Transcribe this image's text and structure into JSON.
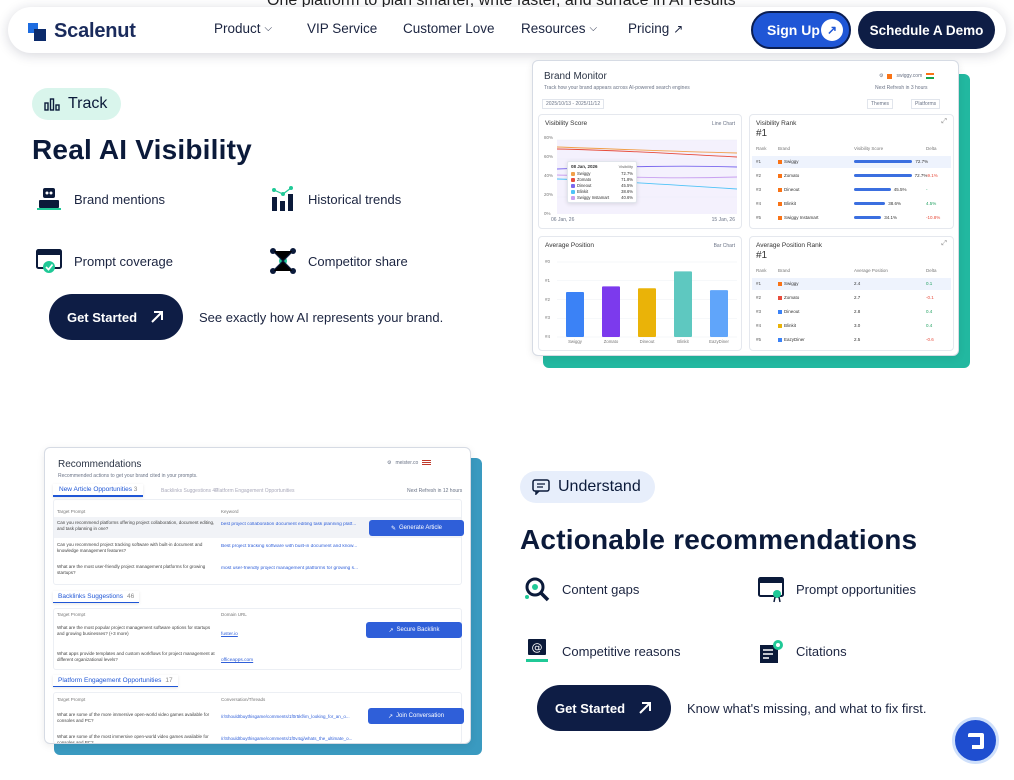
{
  "top_banner": "One platform to plan smarter, write faster, and surface in AI results",
  "nav": {
    "brand": "Scalenut",
    "items": [
      {
        "label": "Product",
        "has_dropdown": true
      },
      {
        "label": "VIP Service",
        "has_dropdown": false
      },
      {
        "label": "Customer Love",
        "has_dropdown": false
      },
      {
        "label": "Resources",
        "has_dropdown": true
      },
      {
        "label": "Pricing",
        "has_dropdown": false,
        "icon": "external-arrow-icon"
      }
    ],
    "signup": "Sign Up",
    "demo": "Schedule A Demo"
  },
  "track": {
    "pill": "Track",
    "title": "Real AI Visibility",
    "features": [
      "Brand mentions",
      "Historical trends",
      "Prompt coverage",
      "Competitor share"
    ],
    "cta": "Get Started",
    "note": "See exactly how AI represents your brand."
  },
  "brand_monitor": {
    "title": "Brand Monitor",
    "subtitle": "Track how your brand appears across AI-powered search engines",
    "domain": "swiggy.com",
    "date_range": "2025/10/13 - 2025/11/12",
    "filters": [
      "Themes",
      "Platforms"
    ],
    "last_refresh": "Next Refresh in 3 hours",
    "visibility_score": {
      "title": "Visibility Score",
      "chart_type_label": "Line Chart",
      "y_ticks": [
        "80%",
        "60%",
        "40%",
        "20%",
        "0%"
      ],
      "x_ticks": [
        "06 Jan, 26",
        "15 Jan, 26"
      ],
      "tooltip_date": "08 Jan, 2026",
      "tooltip_header": "Visibility",
      "tooltip_rows": [
        {
          "name": "Swiggy",
          "value": "72.7%",
          "color": "#f0a04b"
        },
        {
          "name": "Zomato",
          "value": "71.8%",
          "color": "#e74c3c"
        },
        {
          "name": "Dineout",
          "value": "45.5%",
          "color": "#7b68ee"
        },
        {
          "name": "Blinkit",
          "value": "38.6%",
          "color": "#4fc3f7"
        },
        {
          "name": "Swiggy Instamart",
          "value": "40.6%",
          "color": "#c9a0f0"
        }
      ]
    },
    "visibility_rank": {
      "title": "Visibility Rank",
      "rank": "#1",
      "headers": [
        "Rank",
        "Brand",
        "Visibility Score",
        "Delta"
      ],
      "rows": [
        {
          "rank": "#1",
          "brand": "Swiggy",
          "score": "72.7%",
          "delta": "",
          "fill": 0.73
        },
        {
          "rank": "#2",
          "brand": "Zomato",
          "score": "72.7%",
          "delta": "-9.1%",
          "fill": 0.72
        },
        {
          "rank": "#3",
          "brand": "Dineout",
          "score": "45.5%",
          "delta": "-",
          "fill": 0.46
        },
        {
          "rank": "#4",
          "brand": "Blinkit",
          "score": "38.6%",
          "delta": "4.5%",
          "fill": 0.39
        },
        {
          "rank": "#5",
          "brand": "Swiggy Instamart",
          "score": "34.1%",
          "delta": "-10.8%",
          "fill": 0.34
        }
      ]
    },
    "average_position": {
      "title": "Average Position",
      "chart_type_label": "Bar Chart",
      "y_ticks": [
        "#0",
        "#1",
        "#2",
        "#3",
        "#4"
      ]
    },
    "average_position_rank": {
      "title": "Average Position Rank",
      "rank": "#1",
      "headers": [
        "Rank",
        "Brand",
        "Average Position",
        "Delta"
      ],
      "rows": [
        {
          "rank": "#1",
          "brand": "Swiggy",
          "pos": "2.4",
          "delta": "0.1"
        },
        {
          "rank": "#2",
          "brand": "Zomato",
          "pos": "2.7",
          "delta": "-0.1"
        },
        {
          "rank": "#3",
          "brand": "Dineout",
          "pos": "2.8",
          "delta": "0.4"
        },
        {
          "rank": "#4",
          "brand": "Blinkit",
          "pos": "3.0",
          "delta": "0.4"
        },
        {
          "rank": "#5",
          "brand": "EazyDiner",
          "pos": "2.5",
          "delta": "-0.6"
        }
      ]
    }
  },
  "chart_data": {
    "type": "bar",
    "title": "Average Position",
    "categories": [
      "Swiggy",
      "Zomato",
      "Dineout",
      "Blinkit",
      "EazyDiner"
    ],
    "values": [
      2.4,
      2.7,
      2.6,
      3.5,
      2.5
    ],
    "colors": [
      "#3b82f6",
      "#7c3aed",
      "#eab308",
      "#5ec8c0",
      "#60a5fa"
    ],
    "ylim": [
      0,
      4
    ]
  },
  "recommendations": {
    "title": "Recommendations",
    "subtitle": "Recommended actions to get your brand cited in your prompts.",
    "domain": "meister.co",
    "tabs": [
      {
        "label": "New Article Opportunities",
        "count": "3"
      },
      {
        "label": "Backlinks Suggestions",
        "count": "46"
      },
      {
        "label": "Platform Engagement Opportunities",
        "count": ""
      }
    ],
    "last_refresh": "Next Refresh in 12 hours",
    "article_headers": [
      "Target Prompt",
      "Keyword"
    ],
    "articles": [
      {
        "prompt": "Can you recommend platforms offering project collaboration, document editing, and task planning in one?",
        "keyword": "best project collaboration document editing task planning platf..."
      },
      {
        "prompt": "Can you recommend project tracking software with built-in document and knowledge management features?",
        "keyword": "Best project tracking software with built-in document and know..."
      },
      {
        "prompt": "What are the most user-friendly project management platforms for growing startups?",
        "keyword": "most user-friendly project management platforms for growing s..."
      }
    ],
    "article_button": "Generate Article",
    "backlinks_title": "Backlinks Suggestions",
    "backlinks_count": "46",
    "backlink_headers": [
      "Target Prompt",
      "Domain URL"
    ],
    "backlinks": [
      {
        "prompt": "What are the most popular project management software options for startups and growing businesses? (+3 more)",
        "url": "fuster.io"
      },
      {
        "prompt": "What apps provide templates and custom workflows for project management at different organizational levels?",
        "url": "officeapps.com"
      }
    ],
    "backlink_button": "Secure Backlink",
    "platform_title": "Platform Engagement Opportunities",
    "platform_count": "17",
    "platform_headers": [
      "Target Prompt",
      "Conversation/Threads"
    ],
    "platform_rows": [
      {
        "prompt": "What are some of the more immersive open-world video games available for consoles and PC?",
        "url": "/r/ShouldIbuythisgame/comments/1f0r5kf/im_looking_for_an_o..."
      },
      {
        "prompt": "What are some of the most immersive open-world video games available for consoles and PC?",
        "url": "/r/ShouldIbuythisgame/comments/1f0v4qj/whats_the_ultimate_o..."
      }
    ],
    "platform_button": "Join Conversation"
  },
  "understand": {
    "pill": "Understand",
    "title": "Actionable recommendations",
    "features": [
      "Content gaps",
      "Prompt opportunities",
      "Competitive reasons",
      "Citations"
    ],
    "cta": "Get Started",
    "note": "Know what's missing, and what to fix first."
  }
}
